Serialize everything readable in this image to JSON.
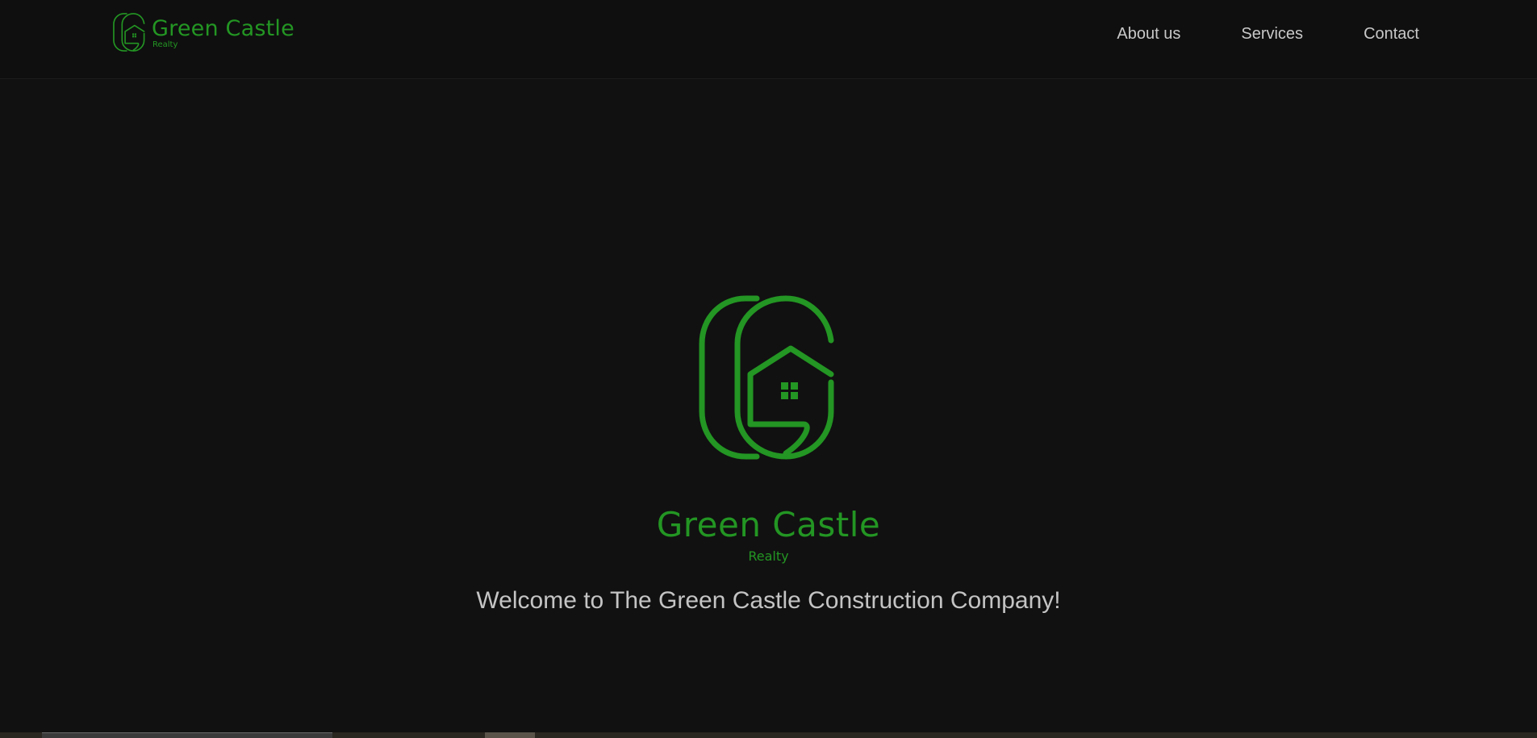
{
  "header": {
    "brand": {
      "name": "Green Castle",
      "tagline": "Realty",
      "logo_icon": "green-castle-house-logo"
    },
    "nav": [
      {
        "label": "About us"
      },
      {
        "label": "Services"
      },
      {
        "label": "Contact"
      }
    ]
  },
  "hero": {
    "logo_icon": "green-castle-house-logo",
    "name": "Green Castle",
    "tagline": "Realty",
    "welcome": "Welcome to The Green Castle Construction Company!"
  },
  "colors": {
    "background": "#111111",
    "brand_green": "#239623",
    "nav_text": "#c8c8c8",
    "welcome_text": "#c4c4c4"
  }
}
